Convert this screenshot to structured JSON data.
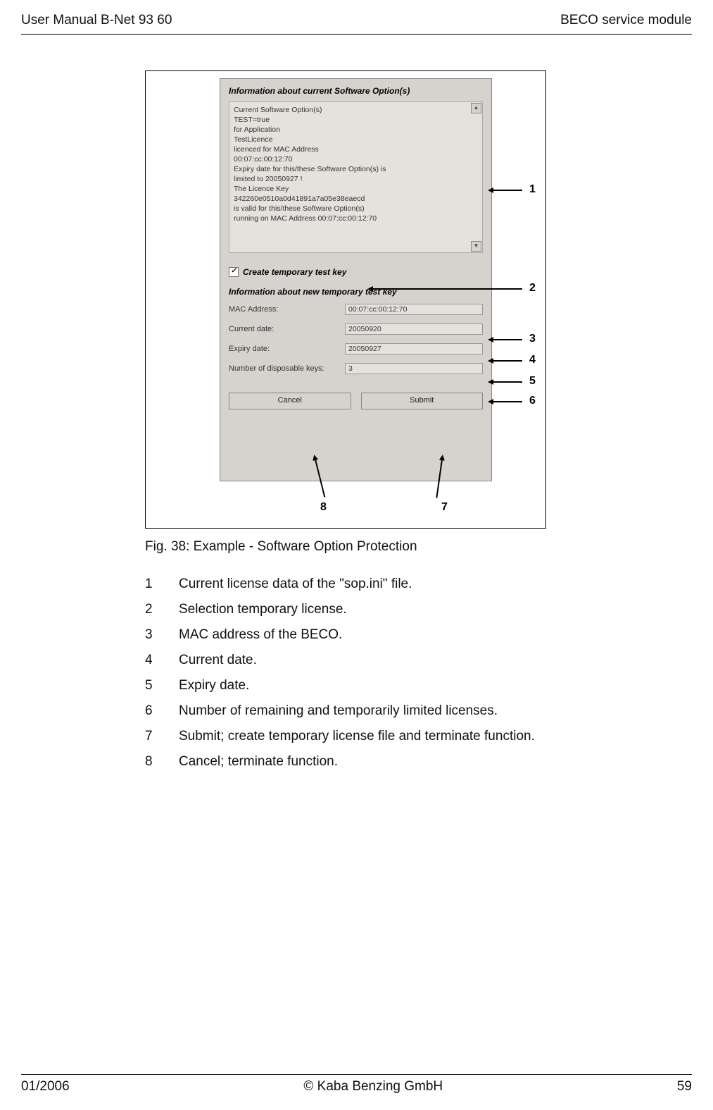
{
  "header": {
    "left": "User Manual B-Net 93 60",
    "right": "BECO service module"
  },
  "dialog": {
    "title1": "Information about current Software Option(s)",
    "info_lines": [
      "Current Software Option(s)",
      "  TEST=true",
      "for Application",
      "  TestLicence",
      "licenced for MAC Address",
      "  00:07:cc:00:12:70",
      "",
      "Expiry date for this/these Software Option(s) is",
      "  limited to 20050927 !",
      "",
      "The Licence Key",
      "  342260e0510a0d41891a7a05e38eaecd",
      "is valid for this/these Software Option(s)",
      "running on MAC Address 00:07:cc:00:12:70"
    ],
    "checkbox_label": "Create temporary test key",
    "section2": "Information about new temporary test key",
    "fields": [
      {
        "label": "MAC Address:",
        "value": "00:07:cc:00:12:70"
      },
      {
        "label": "Current date:",
        "value": "20050920"
      },
      {
        "label": "Expiry date:",
        "value": "20050927"
      },
      {
        "label": "Number of disposable keys:",
        "value": "3"
      }
    ],
    "btn_cancel": "Cancel",
    "btn_submit": "Submit"
  },
  "callouts": {
    "n1": "1",
    "n2": "2",
    "n3": "3",
    "n4": "4",
    "n5": "5",
    "n6": "6",
    "n7": "7",
    "n8": "8"
  },
  "caption": "Fig. 38: Example - Software Option Protection",
  "legend": [
    {
      "n": "1",
      "t": "Current license data of the \"sop.ini\" file."
    },
    {
      "n": "2",
      "t": "Selection temporary license."
    },
    {
      "n": "3",
      "t": "MAC address of the BECO."
    },
    {
      "n": "4",
      "t": "Current date."
    },
    {
      "n": "5",
      "t": "Expiry date."
    },
    {
      "n": "6",
      "t": "Number of remaining and temporarily limited licenses."
    },
    {
      "n": "7",
      "t": "Submit; create temporary license file and terminate function."
    },
    {
      "n": "8",
      "t": "Cancel; terminate function."
    }
  ],
  "footer": {
    "left": "01/2006",
    "center": "© Kaba Benzing GmbH",
    "right": "59"
  }
}
